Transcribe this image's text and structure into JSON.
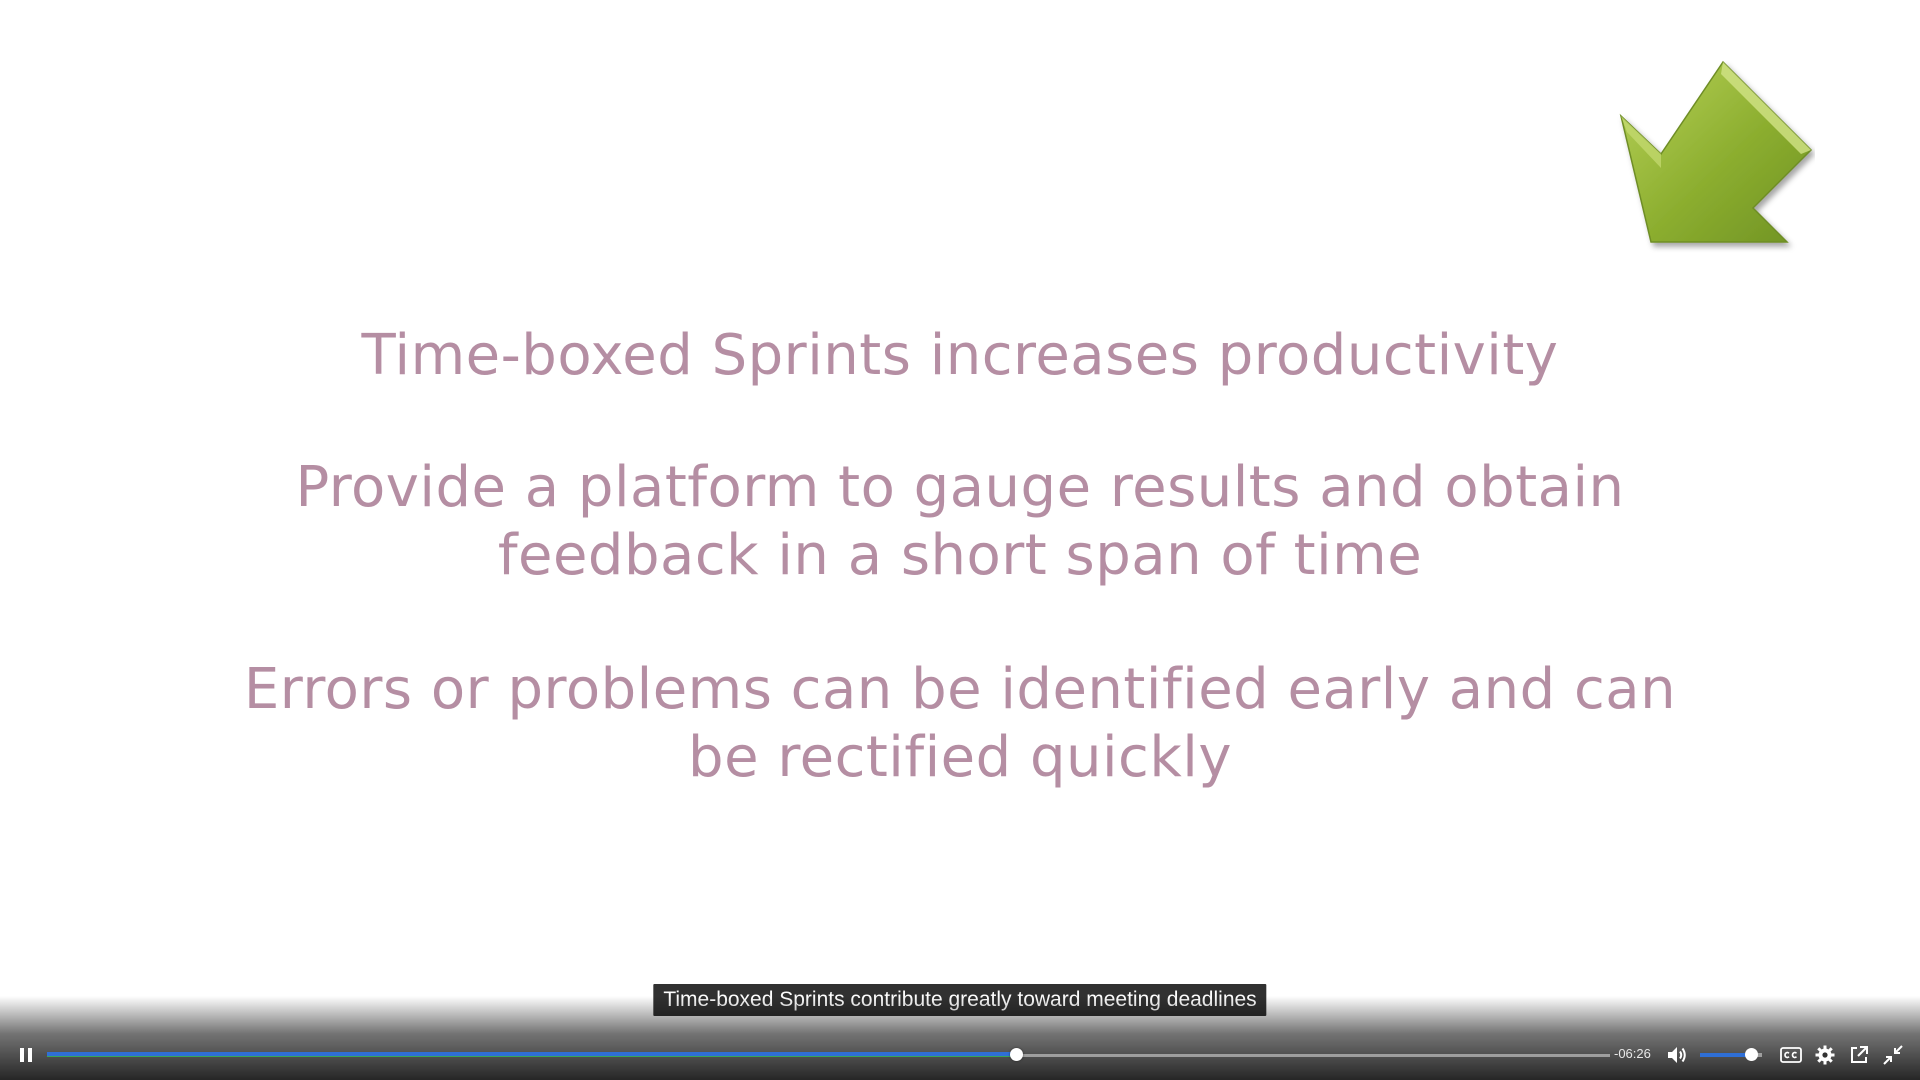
{
  "slide": {
    "line1": "Time-boxed Sprints increases productivity",
    "line2": "Provide a platform to gauge results and obtain feedback in a short span of time",
    "line3": "Errors or problems can be identified early and can be rectified quickly"
  },
  "arrow_icon": "green-arrow-down-left-icon",
  "caption": "Time-boxed Sprints contribute greatly toward meeting deadlines",
  "player": {
    "progress_fraction": 0.62,
    "buffered_fraction": 0.62,
    "time_remaining": "-06:26",
    "volume_fraction": 0.82,
    "icons": {
      "play_pause": "pause-icon",
      "volume": "volume-icon",
      "captions": "closed-captions-icon",
      "settings": "gear-icon",
      "popout": "popout-icon",
      "exit_fullscreen": "exit-fullscreen-icon"
    },
    "colors": {
      "progress": "#2f6fd6",
      "buffer": "#3aa35a"
    }
  }
}
